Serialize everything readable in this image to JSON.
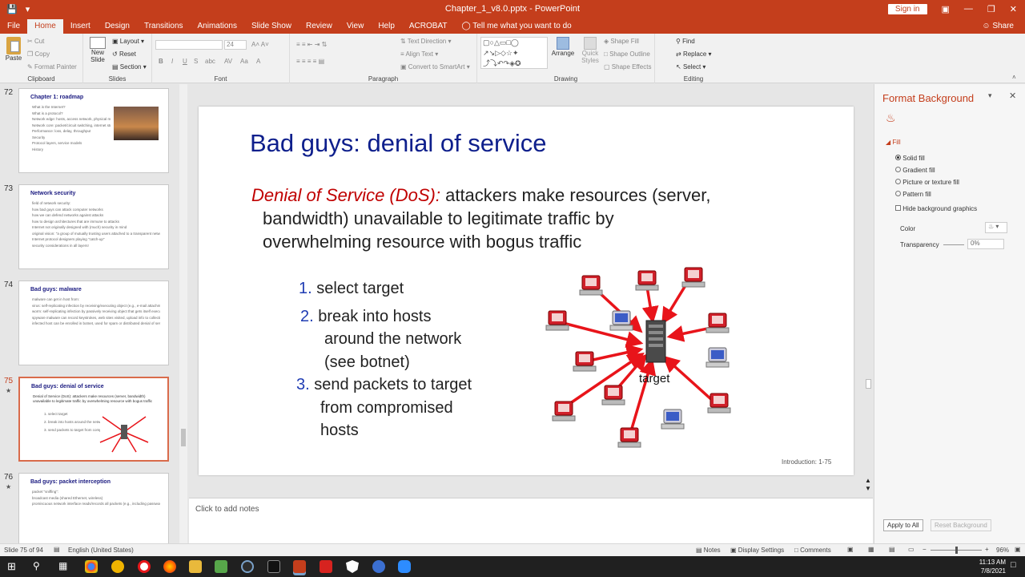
{
  "window": {
    "title": "Chapter_1_v8.0.pptx  -  PowerPoint",
    "sign_in": "Sign in",
    "share": "Share",
    "tell_me": "Tell me what you want to do"
  },
  "tabs": [
    "File",
    "Home",
    "Insert",
    "Design",
    "Transitions",
    "Animations",
    "Slide Show",
    "Review",
    "View",
    "Help",
    "ACROBAT"
  ],
  "ribbon": {
    "clipboard": {
      "label": "Clipboard",
      "paste": "Paste",
      "cut": "Cut",
      "copy": "Copy",
      "format_painter": "Format Painter"
    },
    "slides": {
      "label": "Slides",
      "new_slide": "New Slide",
      "layout": "Layout",
      "reset": "Reset",
      "section": "Section"
    },
    "font": {
      "label": "Font",
      "size": "24"
    },
    "paragraph": {
      "label": "Paragraph",
      "text_direction": "Text Direction",
      "align_text": "Align Text",
      "convert": "Convert to SmartArt"
    },
    "drawing": {
      "label": "Drawing",
      "arrange": "Arrange",
      "quick_styles": "Quick Styles",
      "shape_fill": "Shape Fill",
      "shape_outline": "Shape Outline",
      "shape_effects": "Shape Effects"
    },
    "editing": {
      "label": "Editing",
      "find": "Find",
      "replace": "Replace",
      "select": "Select"
    }
  },
  "thumbnails": [
    {
      "num": "72",
      "title": "Chapter 1: roadmap",
      "lines": [
        "What is the Internet?",
        "What is a protocol?",
        "Network edge: hosts, access network, physical media",
        "Network core: packet/circuit switching, internet structure",
        "Performance: loss, delay, throughput",
        "Security",
        "Protocol layers, service models",
        "History"
      ]
    },
    {
      "num": "73",
      "title": "Network security",
      "lines": [
        "field of network security:",
        "how bad guys can attack computer networks",
        "how we can defend networks against attacks",
        "how to design architectures that are immune to attacks",
        "Internet not originally designed with (much) security in mind",
        "original vision: \"a group of mutually trusting users attached to a transparent network\"",
        "Internet protocol designers playing \"catch-up\"",
        "security considerations in all layers!"
      ]
    },
    {
      "num": "74",
      "title": "Bad guys: malware",
      "lines": [
        "malware can get in host from:",
        "virus: self-replicating infection by receiving/executing object (e.g., e-mail attachment)",
        "worm: self-replicating infection by passively receiving object that gets itself executed",
        "spyware malware can record keystrokes, web sites visited, upload info to collection site",
        "infected host can be enrolled in botnet, used for spam or distributed denial of service (DDoS) attacks"
      ]
    },
    {
      "num": "75",
      "title": "Bad guys: denial of service",
      "lines": [
        "Denial of Service (DoS): attackers make resources (server, bandwidth) unavailable to legitimate traffic by overwhelming resource with bogus traffic",
        "1. select target",
        "2. break into hosts around the network (see botnet)",
        "3. send packets to target from compromised hosts"
      ]
    },
    {
      "num": "76",
      "title": "Bad guys: packet interception",
      "lines": [
        "packet \"sniffing\":",
        "broadcast media (shared Ethernet, wireless)",
        "promiscuous network interface reads/records all packets (e.g., including passwords!) passing by"
      ]
    }
  ],
  "slide": {
    "title": "Bad guys: denial of service",
    "dos_term": "Denial of Service (DoS):",
    "dos_line1": " attackers make resources (server,",
    "dos_line2": "bandwidth) unavailable to legitimate traffic by",
    "dos_line3": "overwhelming resource with bogus traffic",
    "steps": [
      {
        "num": "1.",
        "lines": [
          "select target"
        ]
      },
      {
        "num": "2.",
        "lines": [
          "break into hosts",
          "around the network",
          "(see botnet)"
        ]
      },
      {
        "num": "3.",
        "lines": [
          "send packets to target",
          "from compromised",
          "hosts"
        ]
      }
    ],
    "target_label": "target",
    "footer": "Introduction: 1-75"
  },
  "notes_placeholder": "Click to add notes",
  "format_pane": {
    "title": "Format Background",
    "section": "Fill",
    "options": [
      "Solid fill",
      "Gradient fill",
      "Picture or texture fill",
      "Pattern fill"
    ],
    "hide_graphics": "Hide background graphics",
    "color_label": "Color",
    "transparency_label": "Transparency",
    "transparency_value": "0%",
    "apply_all": "Apply to All",
    "reset_bg": "Reset Background"
  },
  "status": {
    "slide_info": "Slide 75 of 94",
    "language": "English (United States)",
    "notes": "Notes",
    "display_settings": "Display Settings",
    "comments": "Comments",
    "zoom": "96%"
  },
  "clock": {
    "time": "11:13 AM",
    "date": "7/8/2021"
  },
  "colors": {
    "accent": "#c43e1c",
    "slide_title": "#0e1f8c",
    "dos_red": "#c00000",
    "step_num": "#1f3cb3",
    "arrow": "#e8141a"
  }
}
